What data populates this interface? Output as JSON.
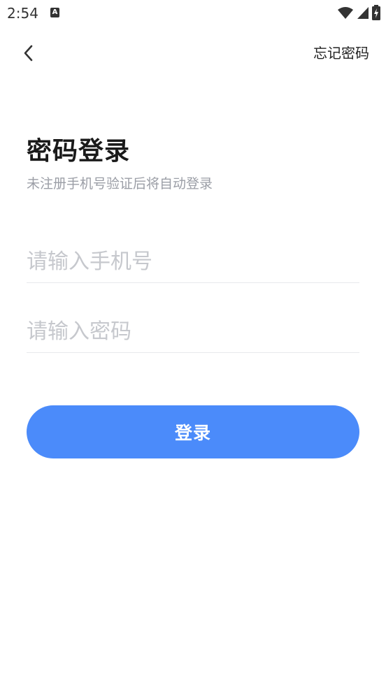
{
  "status_bar": {
    "time": "2:54",
    "notification_icon": "A",
    "icons": [
      "wifi-icon",
      "signal-icon",
      "battery-charging-icon"
    ]
  },
  "nav": {
    "back_icon": "chevron-left-icon",
    "forgot_password": "忘记密码"
  },
  "login": {
    "title": "密码登录",
    "subtitle": "未注册手机号验证后将自动登录",
    "phone_placeholder": "请输入手机号",
    "phone_value": "",
    "password_placeholder": "请输入密码",
    "password_value": "",
    "submit_label": "登录"
  },
  "colors": {
    "primary": "#4b8bfa",
    "title": "#1a1a1a",
    "subtitle": "#9b9ea6",
    "placeholder": "#c6c8cd",
    "divider": "#e8e9ec"
  }
}
